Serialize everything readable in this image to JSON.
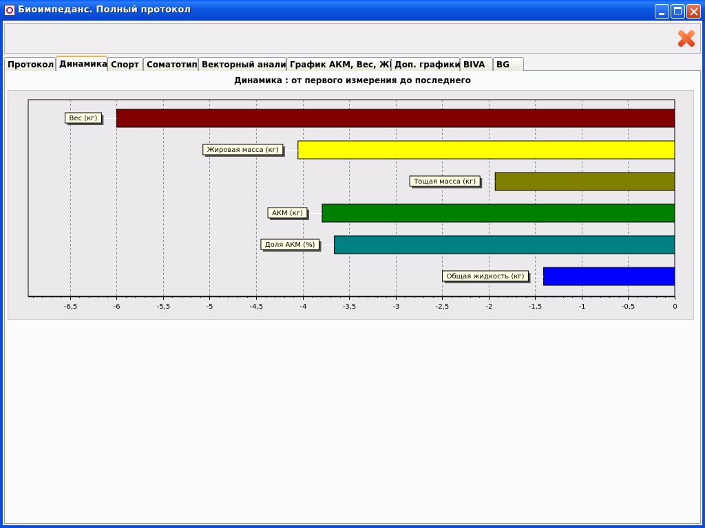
{
  "window": {
    "title": "Биоимпеданс.  Полный протокол"
  },
  "tabs": [
    {
      "label": "Протокол",
      "active": false
    },
    {
      "label": "Динамика",
      "active": true
    },
    {
      "label": "Спорт",
      "active": false
    },
    {
      "label": "Соматотип",
      "active": false
    },
    {
      "label": "Векторный анализ",
      "active": false
    },
    {
      "label": "График АКМ, Вес, ЖМ",
      "active": false
    },
    {
      "label": "Доп. графики",
      "active": false
    },
    {
      "label": "BIVA",
      "active": false
    },
    {
      "label": "BG",
      "active": false
    }
  ],
  "toolbar": {
    "close_icon": "close-x-icon"
  },
  "chart_data": {
    "type": "bar",
    "orientation": "horizontal",
    "title": "Динамика :  от первого измерения до последнего",
    "categories": [
      "Вес (кг)",
      "Жировая масса (кг)",
      "Тощая масса (кг)",
      "АКМ (кг)",
      "Доля АКМ (%)",
      "Общая жидкость (кг)"
    ],
    "values": [
      -6.0,
      -4.05,
      -1.93,
      -3.79,
      -3.66,
      -1.41
    ],
    "colors": [
      "#800000",
      "#ffff00",
      "#808000",
      "#008000",
      "#008080",
      "#0000ff"
    ],
    "xlim": [
      -6.95,
      0
    ],
    "xticks": [
      -6.5,
      -6,
      -5.5,
      -5,
      -4.5,
      -4,
      -3.5,
      -3,
      -2.5,
      -2,
      -1.5,
      -1,
      -0.5,
      0
    ],
    "xtick_labels": [
      "-6,5",
      "-6",
      "-5,5",
      "-5",
      "-4,5",
      "-4",
      "-3,5",
      "-3",
      "-2,5",
      "-2",
      "-1,5",
      "-1",
      "-0,5",
      "0"
    ],
    "grid": true,
    "grid_style": "dashed-vertical"
  }
}
